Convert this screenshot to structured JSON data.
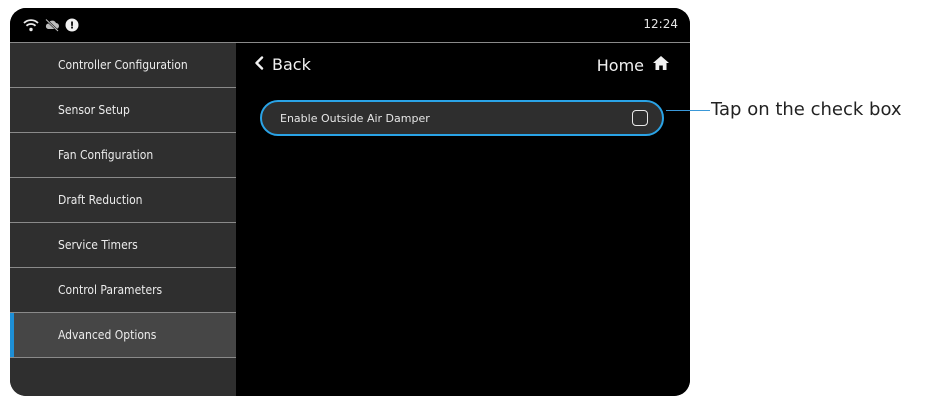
{
  "status_bar": {
    "time": "12:24",
    "icons": [
      "wifi-icon",
      "cloud-off-icon",
      "alert-info-icon"
    ],
    "alert_badge": "!"
  },
  "sidebar": {
    "items": [
      {
        "label": "Controller Configuration",
        "active": false
      },
      {
        "label": "Sensor Setup",
        "active": false
      },
      {
        "label": "Fan Configuration",
        "active": false
      },
      {
        "label": "Draft Reduction",
        "active": false
      },
      {
        "label": "Service Timers",
        "active": false
      },
      {
        "label": "Control Parameters",
        "active": false
      },
      {
        "label": "Advanced Options",
        "active": true
      }
    ]
  },
  "header": {
    "back_label": "Back",
    "home_label": "Home"
  },
  "options": [
    {
      "label": "Enable Outside Air Damper",
      "checked": false
    }
  ],
  "annotation": {
    "text": "Tap on the check box"
  },
  "colors": {
    "accent": "#2aa3e6",
    "background": "#000000",
    "sidebar": "#2f2f2f",
    "sidebar_active": "#464646"
  }
}
